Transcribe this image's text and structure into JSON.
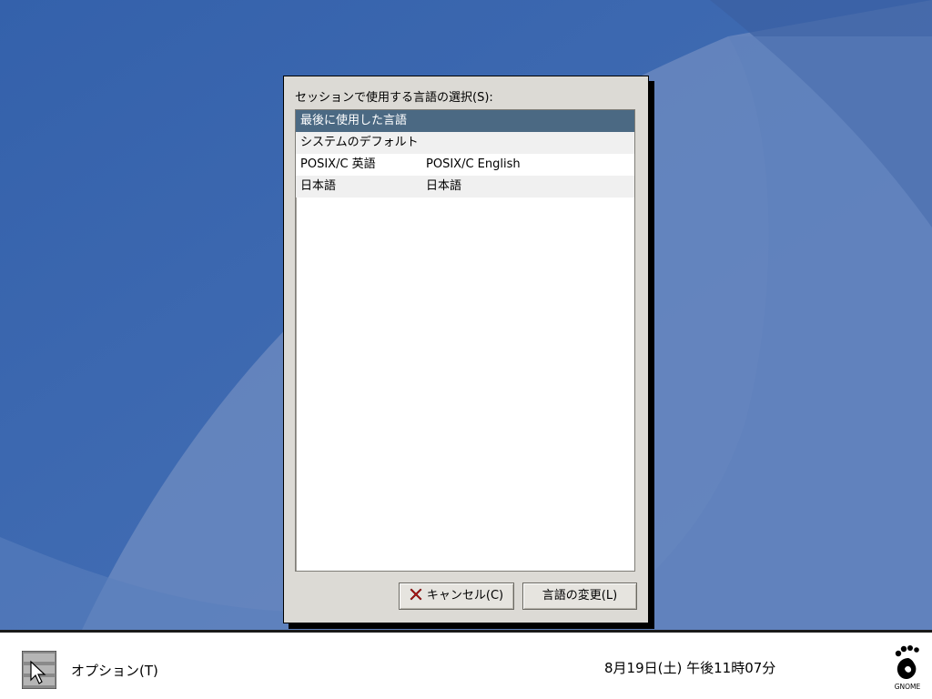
{
  "dialog": {
    "prompt": "セッションで使用する言語の選択(S):",
    "languages": [
      {
        "name": "最後に使用した言語",
        "native": "",
        "selected": true
      },
      {
        "name": "システムのデフォルト",
        "native": "",
        "selected": false
      },
      {
        "name": "POSIX/C 英語",
        "native": "POSIX/C English",
        "selected": false
      },
      {
        "name": "日本語",
        "native": "日本語",
        "selected": false
      }
    ],
    "cancel_label": "キャンセル(C)",
    "change_label": "言語の変更(L)"
  },
  "panel": {
    "options_label": "オプション(T)",
    "clock": "8月19日(土) 午後11時07分",
    "logo_text": "GNOME"
  },
  "colors": {
    "desktop_base": "#3f66ad",
    "selection": "#4b6983",
    "dialog_bg": "#dcdad5"
  }
}
